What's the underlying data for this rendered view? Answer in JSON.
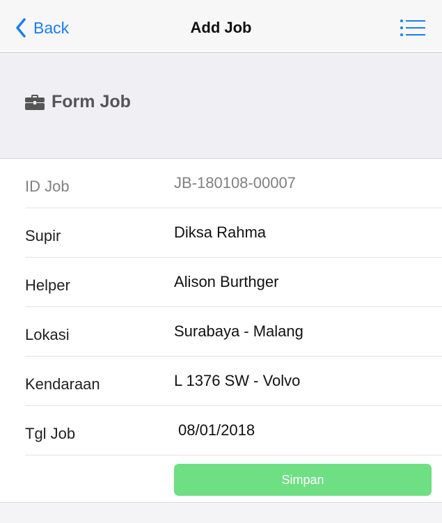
{
  "navbar": {
    "back_label": "Back",
    "title": "Add Job",
    "menu_icon": "list-menu-icon",
    "accent_color": "#1a7cf5"
  },
  "section": {
    "title": "Form Job",
    "icon": "briefcase-icon"
  },
  "form": {
    "fields": [
      {
        "label": "ID Job",
        "value": "JB-180108-00007"
      },
      {
        "label": "Supir",
        "value": "Diksa Rahma"
      },
      {
        "label": "Helper",
        "value": "Alison Burthger"
      },
      {
        "label": "Lokasi",
        "value": "Surabaya - Malang"
      },
      {
        "label": "Kendaraan",
        "value": "L 1376 SW - Volvo"
      },
      {
        "label": "Tgl Job",
        "value": "08/01/2018"
      }
    ],
    "save_label": "Simpan",
    "save_color": "#6fdf84"
  }
}
